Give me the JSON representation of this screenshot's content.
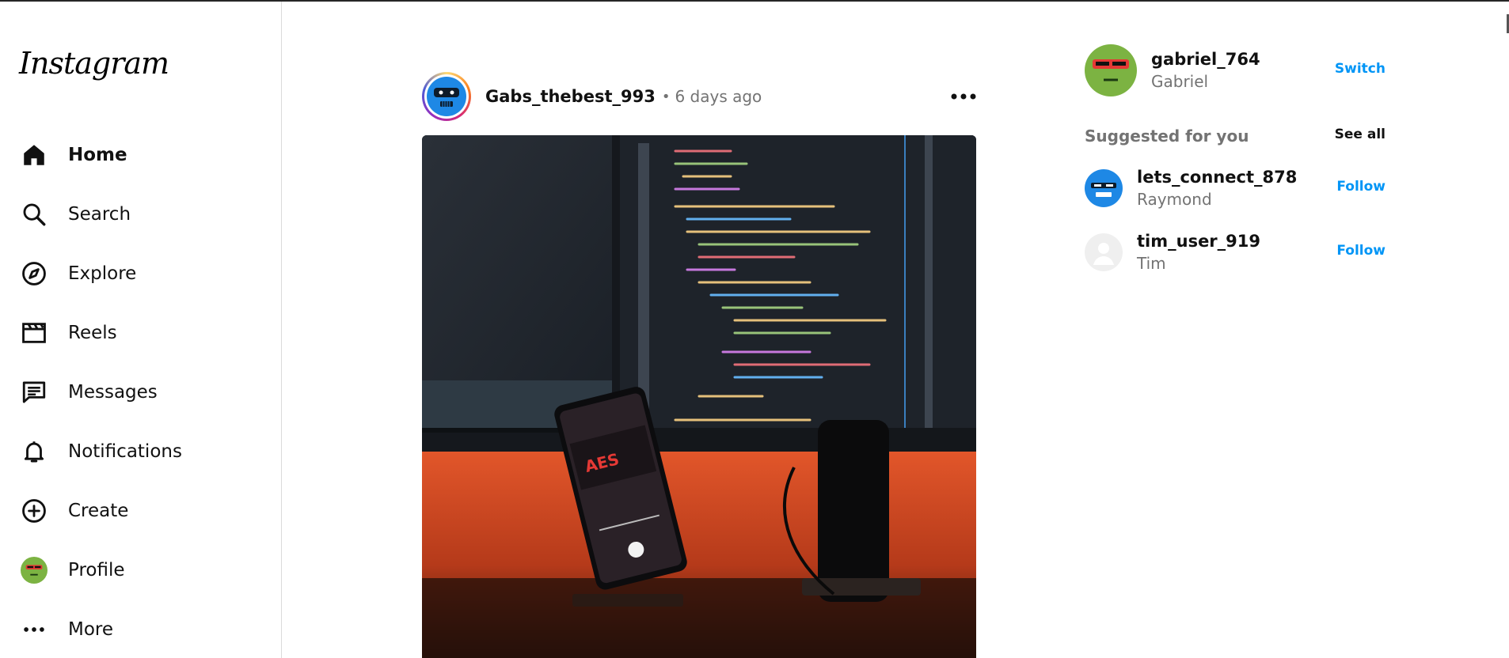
{
  "app": {
    "logo_text": "Instagram"
  },
  "sidebar": {
    "items": [
      {
        "label": "Home",
        "icon": "home-icon",
        "active": true
      },
      {
        "label": "Search",
        "icon": "search-icon"
      },
      {
        "label": "Explore",
        "icon": "compass-icon"
      },
      {
        "label": "Reels",
        "icon": "reels-icon"
      },
      {
        "label": "Messages",
        "icon": "messages-icon"
      },
      {
        "label": "Notifications",
        "icon": "bell-icon"
      },
      {
        "label": "Create",
        "icon": "plus-circle-icon"
      },
      {
        "label": "Profile",
        "icon": "profile-avatar"
      },
      {
        "label": "More",
        "icon": "more-icon"
      }
    ]
  },
  "post": {
    "username": "Gabs_thebest_993",
    "separator": "•",
    "time": "6 days ago",
    "image_subject": "dark-desk-setup-with-code-monitor-and-phone"
  },
  "account": {
    "username": "gabriel_764",
    "name": "Gabriel",
    "switch_label": "Switch"
  },
  "suggestions": {
    "title": "Suggested for you",
    "see_all_label": "See all",
    "users": [
      {
        "username": "lets_connect_878",
        "name": "Raymond",
        "action": "Follow"
      },
      {
        "username": "tim_user_919",
        "name": "Tim",
        "action": "Follow"
      }
    ]
  },
  "colors": {
    "link_blue": "#0095f6",
    "muted_text": "#737373",
    "divider": "#dbdbdb",
    "avatar_green": "#7cb342",
    "visor_red": "#e53935",
    "robot_blue": "#1e88e5"
  }
}
